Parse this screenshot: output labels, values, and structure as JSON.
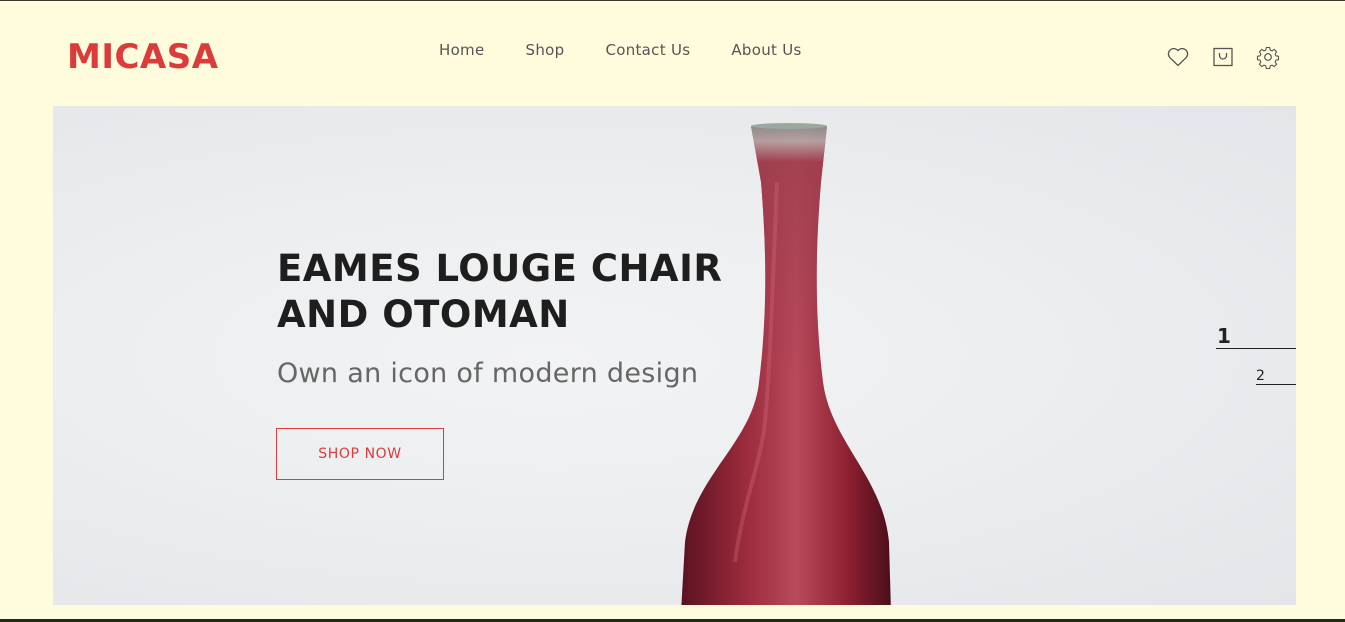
{
  "brand": {
    "logo": "MICASA",
    "color": "#dc3b3c"
  },
  "nav": {
    "items": [
      {
        "label": "Home"
      },
      {
        "label": "Shop"
      },
      {
        "label": "Contact Us"
      },
      {
        "label": "About Us"
      }
    ]
  },
  "header_icons": [
    "heart-icon",
    "shopping-bag-icon",
    "gear-icon"
  ],
  "hero": {
    "title_line1": "EAMES LOUGE CHAIR",
    "title_line2": "AND OTOMAN",
    "subtitle": "Own an icon of modern design",
    "cta_label": "SHOP NOW",
    "slides": [
      {
        "label": "1",
        "active": true
      },
      {
        "label": "2",
        "active": false
      }
    ]
  },
  "colors": {
    "background": "#fefcdc",
    "accent": "#dc3b3c",
    "vase": "#8c1f30"
  }
}
